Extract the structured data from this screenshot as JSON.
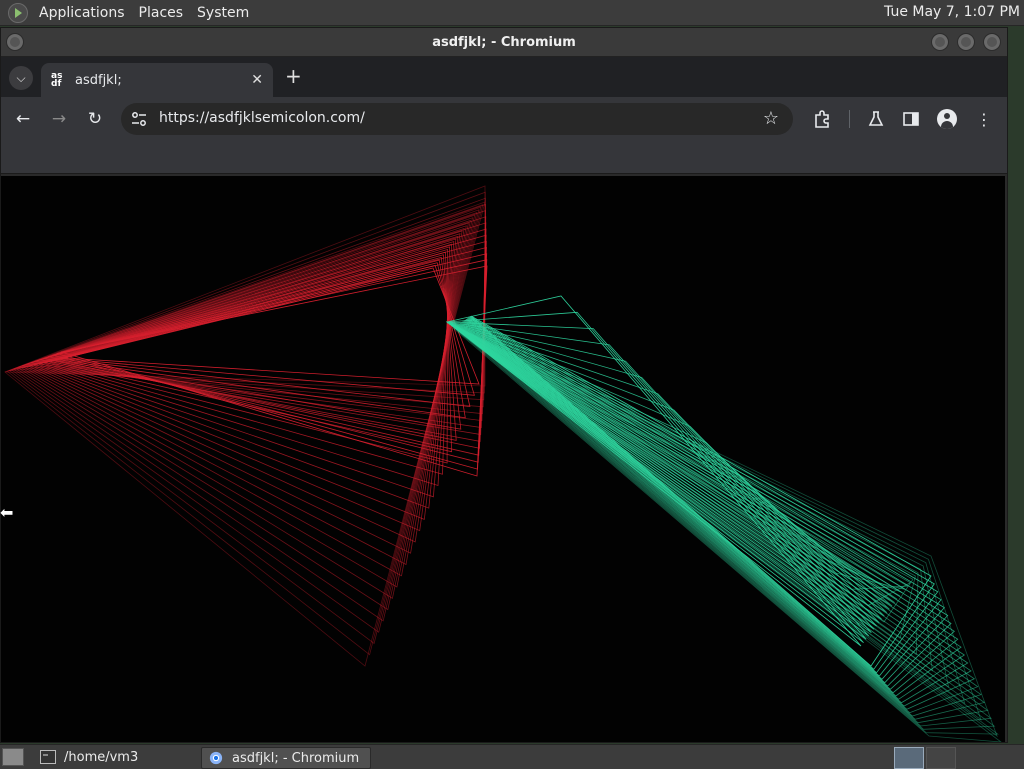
{
  "top_panel": {
    "menus": [
      "Applications",
      "Places",
      "System"
    ],
    "clock": "Tue May  7,  1:07 PM"
  },
  "window": {
    "title": "asdfjkl; - Chromium"
  },
  "browser": {
    "tab": {
      "title": "asdfjkl;",
      "favicon_text": "as df"
    },
    "toolbar": {
      "url": "https://asdfjklsemicolon.com/"
    },
    "icons": {
      "back": "back-arrow-icon",
      "forward": "forward-arrow-icon",
      "reload": "reload-icon",
      "site_info": "tune-icon",
      "bookmark": "star-icon",
      "extensions": "puzzle-icon",
      "labs": "flask-icon",
      "side_panel": "side-panel-icon",
      "profile": "person-icon",
      "menu": "kebab-menu-icon"
    }
  },
  "page": {
    "colors": {
      "background": "#020202",
      "red_lines": "#d8202e",
      "green_lines": "#2fd7a0"
    }
  },
  "taskbar": {
    "tasks": [
      {
        "label": "/home/vm3"
      },
      {
        "label": "asdfjkl; - Chromium"
      }
    ]
  }
}
